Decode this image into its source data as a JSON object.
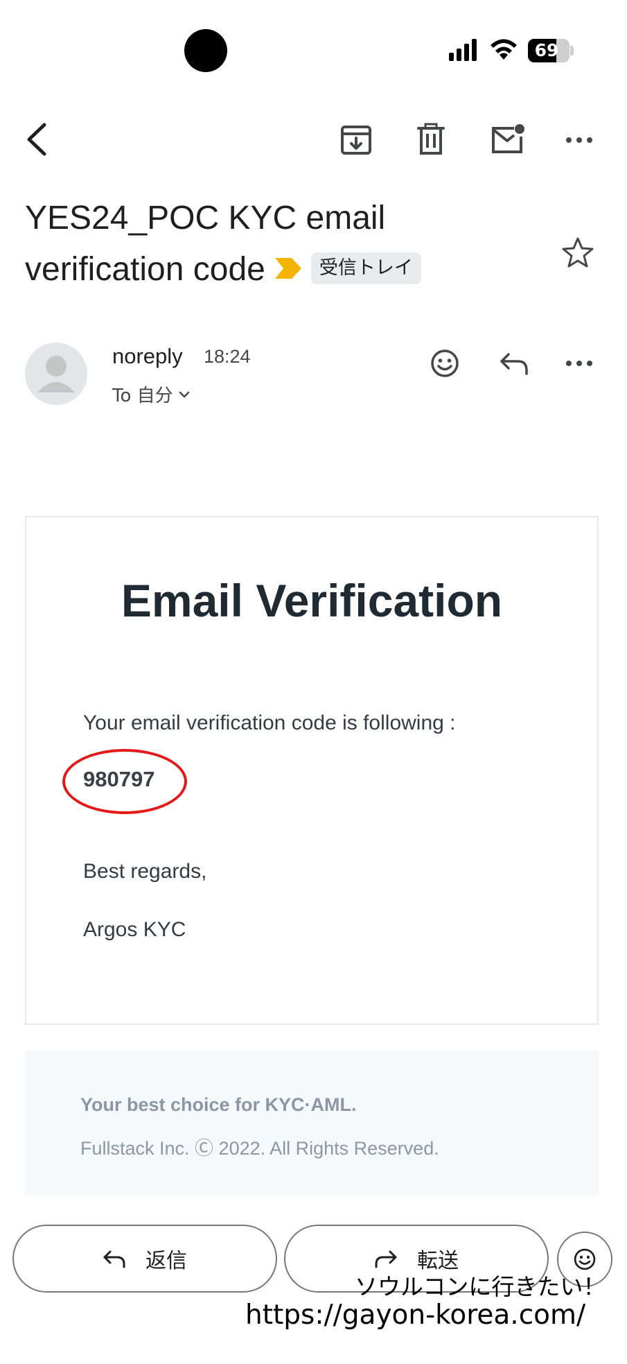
{
  "status_bar": {
    "battery_level": "69"
  },
  "toolbar": {
    "back_icon": "back-arrow-icon",
    "archive_icon": "archive-icon",
    "delete_icon": "trash-icon",
    "unread_icon": "mark-unread-icon",
    "more_icon": "more-horizontal-icon"
  },
  "email": {
    "subject": "YES24_POC KYC email verification code",
    "label": "受信トレイ",
    "sender": "noreply",
    "time": "18:24",
    "recipient": "To 自分"
  },
  "body": {
    "heading": "Email Verification",
    "intro": "Your email verification code is following :",
    "code": "980797",
    "closing": "Best regards,",
    "signature": "Argos KYC",
    "highlight_color": "#e41a1a"
  },
  "footer": {
    "tagline": "Your best choice for KYC·AML.",
    "copyright": "Fullstack Inc. Ⓒ 2022. All Rights Reserved."
  },
  "actions": {
    "reply_label": "返信",
    "forward_label": "転送"
  },
  "watermark": {
    "line1": "ソウルコンに行きたい！",
    "line2": "https://gayon-korea.com/"
  },
  "colors": {
    "label_arrow": "#f4b400",
    "text_primary": "#1f1f1f",
    "text_secondary": "#444746"
  }
}
